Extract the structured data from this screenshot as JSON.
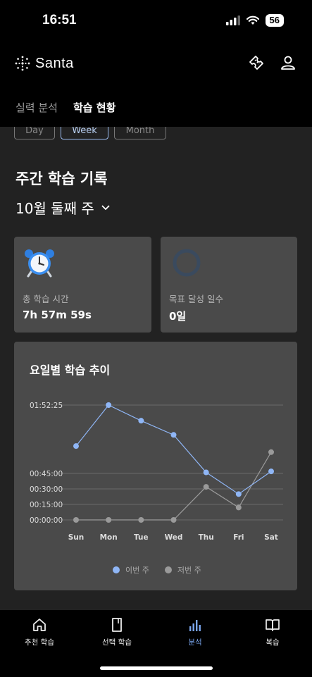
{
  "status_bar": {
    "time": "16:51",
    "battery": "56"
  },
  "header": {
    "app_name": "Santa",
    "icons": [
      "ticket-icon",
      "user-icon"
    ]
  },
  "tabs": [
    {
      "label": "실력 분석",
      "active": false
    },
    {
      "label": "학습 현황",
      "active": true
    }
  ],
  "period": [
    {
      "label": "Day",
      "active": false
    },
    {
      "label": "Week",
      "active": true
    },
    {
      "label": "Month",
      "active": false
    }
  ],
  "section_title": "주간 학습 기록",
  "week_label": "10월 둘째 주",
  "stats": {
    "study_time": {
      "label": "총 학습 시간",
      "value": "7h 57m 59s",
      "icon": "alarm-clock-icon"
    },
    "goal_days": {
      "label": "목표 달성 일수",
      "value": "0일",
      "icon": "progress-ring-icon",
      "progress": 0
    }
  },
  "chart_title": "요일별 학습 추이",
  "chart_data": {
    "type": "line",
    "categories": [
      "Sun",
      "Mon",
      "Tue",
      "Wed",
      "Thu",
      "Fri",
      "Sat"
    ],
    "y_ticks": [
      "00:00:00",
      "00:15:00",
      "00:30:00",
      "00:45:00",
      "01:52:25"
    ],
    "y_tick_minutes": [
      0,
      15,
      30,
      45,
      112.4
    ],
    "series": [
      {
        "name": "이번 주",
        "color": "#8fb6f6",
        "values": [
          72,
          112.4,
          97,
          83,
          46,
          25,
          47
        ]
      },
      {
        "name": "저번 주",
        "color": "#9a9a9a",
        "values": [
          0,
          0,
          0,
          0,
          32,
          12,
          66
        ]
      }
    ]
  },
  "nav": [
    {
      "label": "추천 학습",
      "icon": "home-icon",
      "active": false
    },
    {
      "label": "선택 학습",
      "icon": "bookmark-icon",
      "active": false
    },
    {
      "label": "분석",
      "icon": "bar-chart-icon",
      "active": true
    },
    {
      "label": "복습",
      "icon": "book-icon",
      "active": false
    }
  ]
}
